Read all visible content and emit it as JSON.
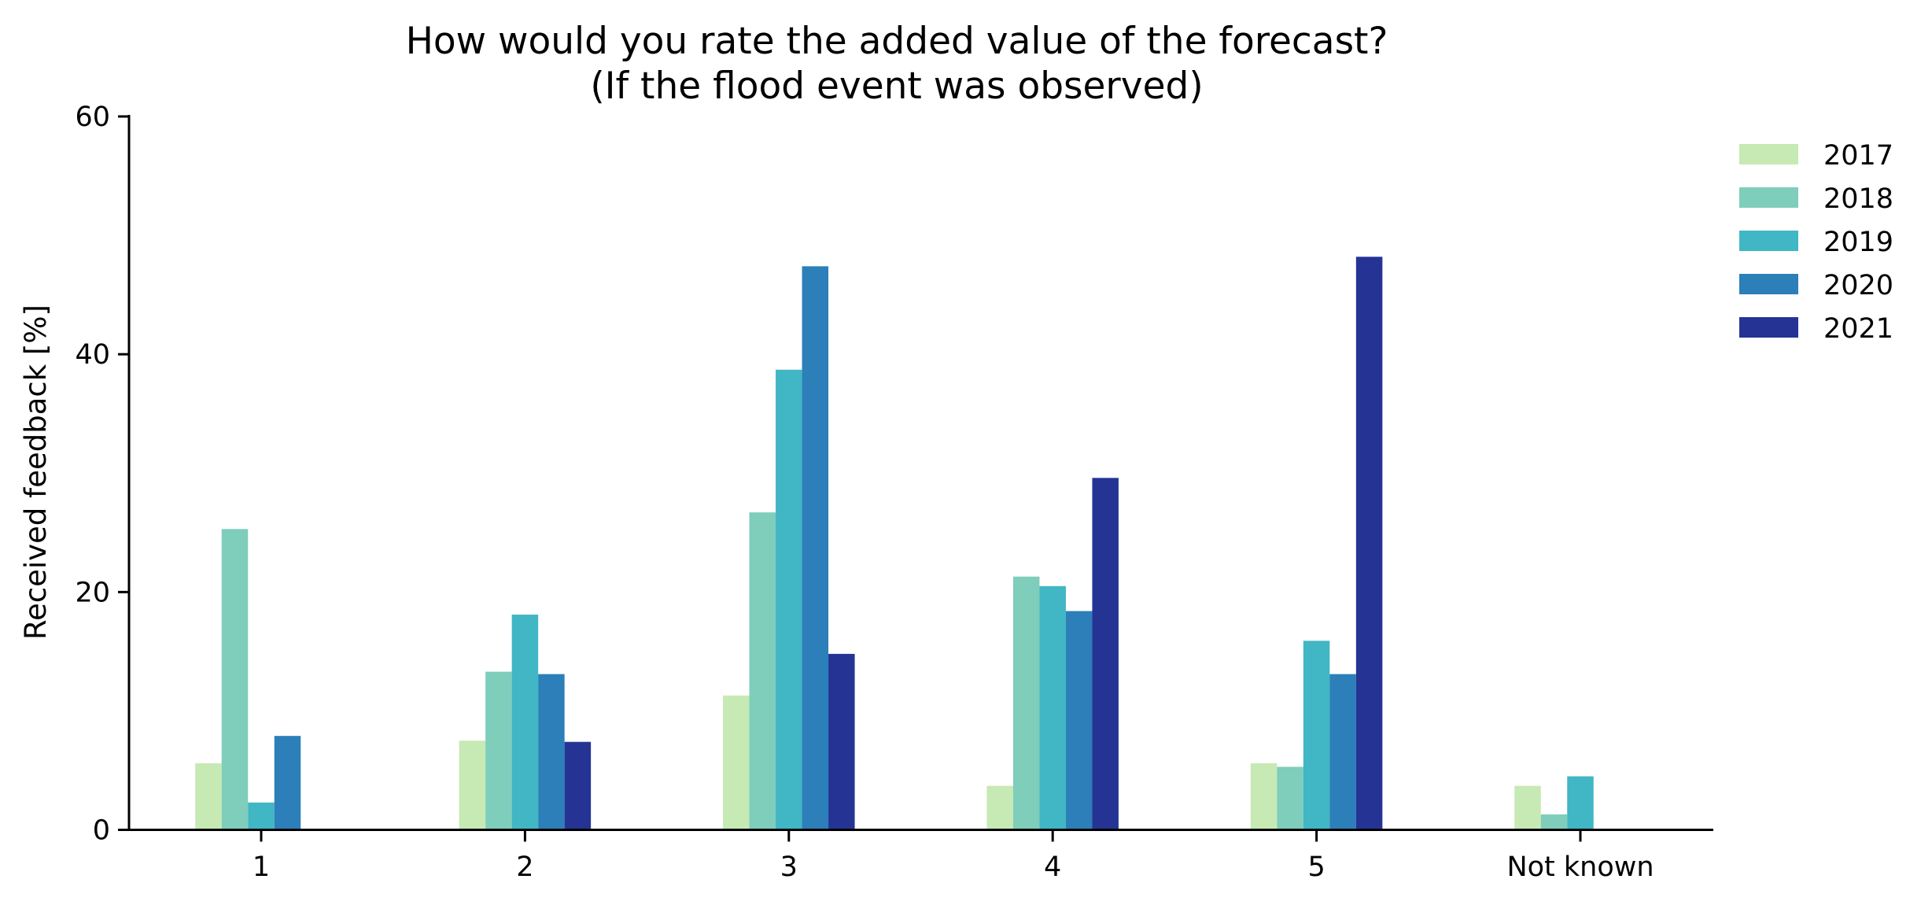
{
  "chart_data": {
    "type": "bar",
    "title": [
      "How would you rate the added value of the forecast?",
      "(If the flood event was observed)"
    ],
    "xlabel": "",
    "ylabel": "Received feedback [%]",
    "categories": [
      "1",
      "2",
      "3",
      "4",
      "5",
      "Not known"
    ],
    "ylim": [
      0,
      60
    ],
    "yticks": [
      0,
      20,
      40,
      60
    ],
    "ytick_labels": [
      "0",
      "20",
      "40",
      "60"
    ],
    "grid": false,
    "legend_position": "top-right-outside",
    "series": [
      {
        "name": "2017",
        "color": "#c7e9b4",
        "values": [
          5.6,
          7.5,
          11.3,
          3.7,
          5.6,
          3.7
        ]
      },
      {
        "name": "2018",
        "color": "#7fcdbb",
        "values": [
          25.3,
          13.3,
          26.7,
          21.3,
          5.3,
          1.3
        ]
      },
      {
        "name": "2019",
        "color": "#41b6c4",
        "values": [
          2.3,
          18.1,
          38.7,
          20.5,
          15.9,
          4.5
        ]
      },
      {
        "name": "2020",
        "color": "#2c7fb8",
        "values": [
          7.9,
          13.1,
          47.4,
          18.4,
          13.1,
          0
        ]
      },
      {
        "name": "2021",
        "color": "#253494",
        "values": [
          0,
          7.4,
          14.8,
          29.6,
          48.2,
          0
        ]
      }
    ]
  }
}
